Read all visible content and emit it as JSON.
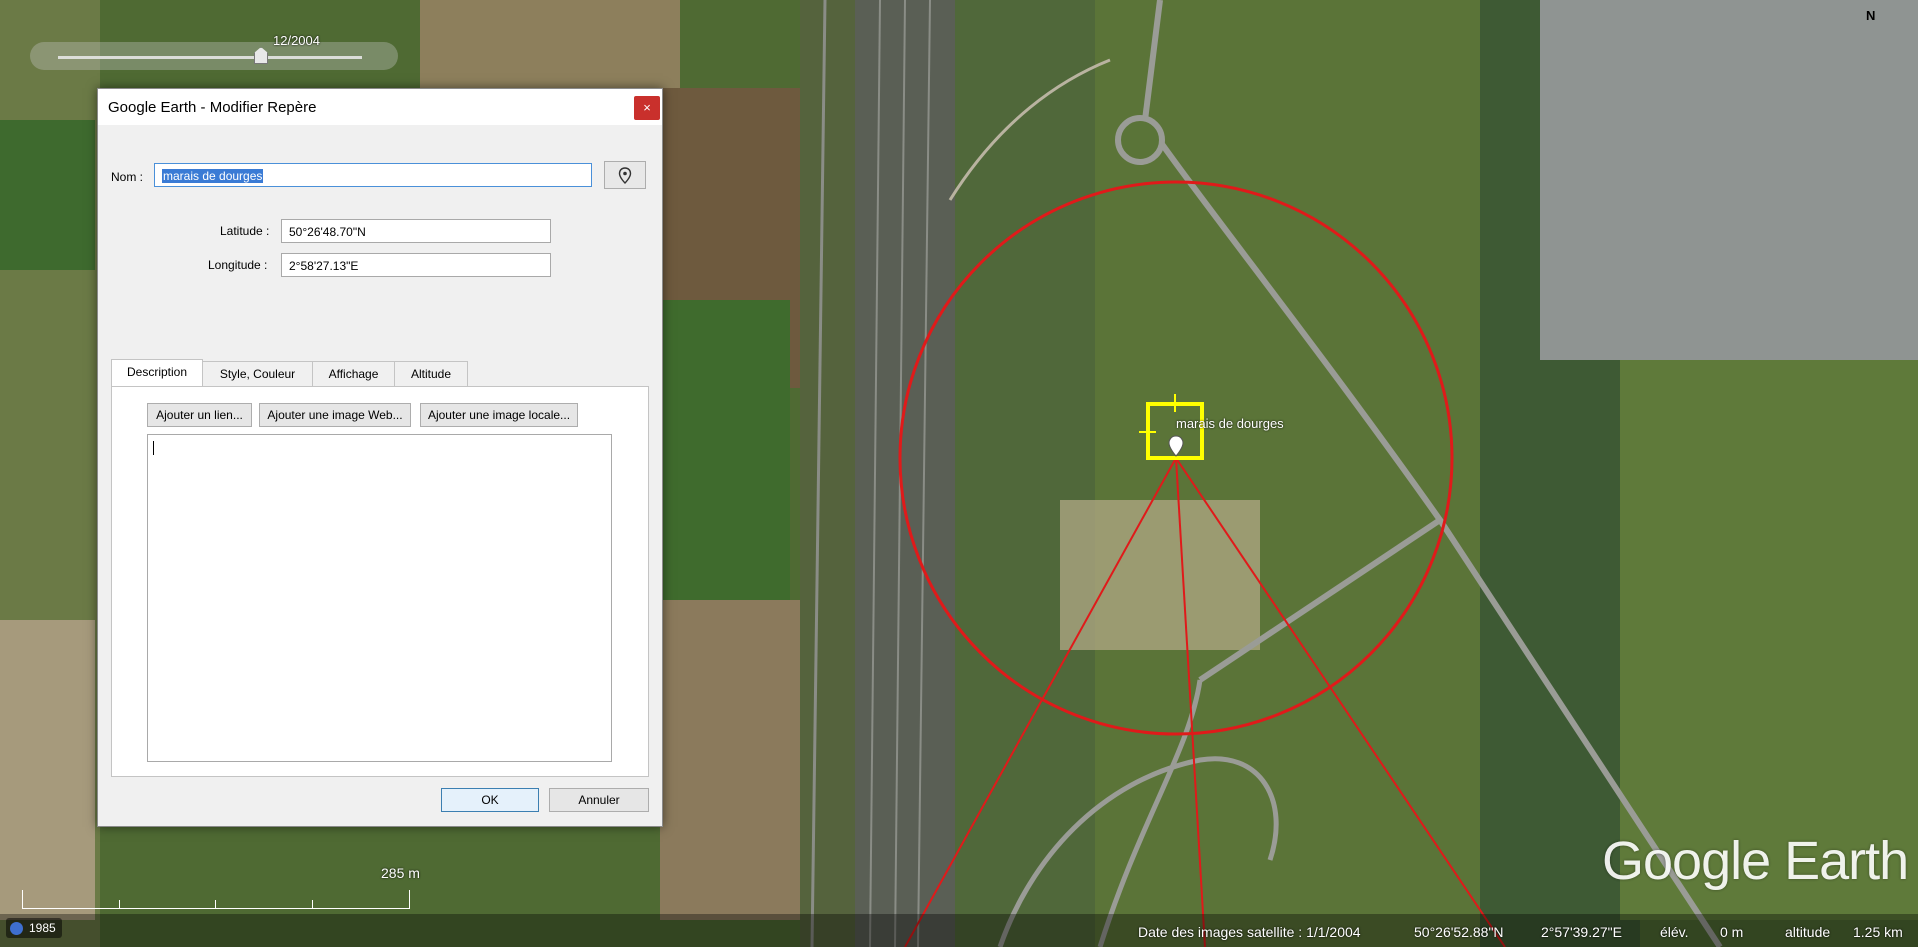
{
  "map": {
    "time_slider_label": "12/2004",
    "placemark_label": "marais de dourges",
    "scale_label": "285 m",
    "logo_text": "Google Earth",
    "compass_letter": "N",
    "year_badge": "1985"
  },
  "dialog": {
    "title": "Google Earth - Modifier Repère",
    "close_label": "×",
    "name_label": "Nom :",
    "name_value": "marais de dourges",
    "latitude_label": "Latitude :",
    "latitude_value": "50°26'48.70\"N",
    "longitude_label": "Longitude :",
    "longitude_value": "2°58'27.13\"E",
    "tabs": [
      {
        "label": "Description"
      },
      {
        "label": "Style, Couleur"
      },
      {
        "label": "Affichage"
      },
      {
        "label": "Altitude"
      }
    ],
    "buttons": {
      "add_link": "Ajouter un lien...",
      "add_web_image": "Ajouter une image Web...",
      "add_local_image": "Ajouter une image locale...",
      "ok": "OK",
      "cancel": "Annuler"
    }
  },
  "status": {
    "imagery_date": "Date des images satellite : 1/1/2004",
    "lat": "50°26'52.88\"N",
    "lon": "2°57'39.27\"E",
    "elev_label": "élév.",
    "elev_value": "0 m",
    "alt_label": "altitude",
    "alt_value": "1.25 km"
  }
}
